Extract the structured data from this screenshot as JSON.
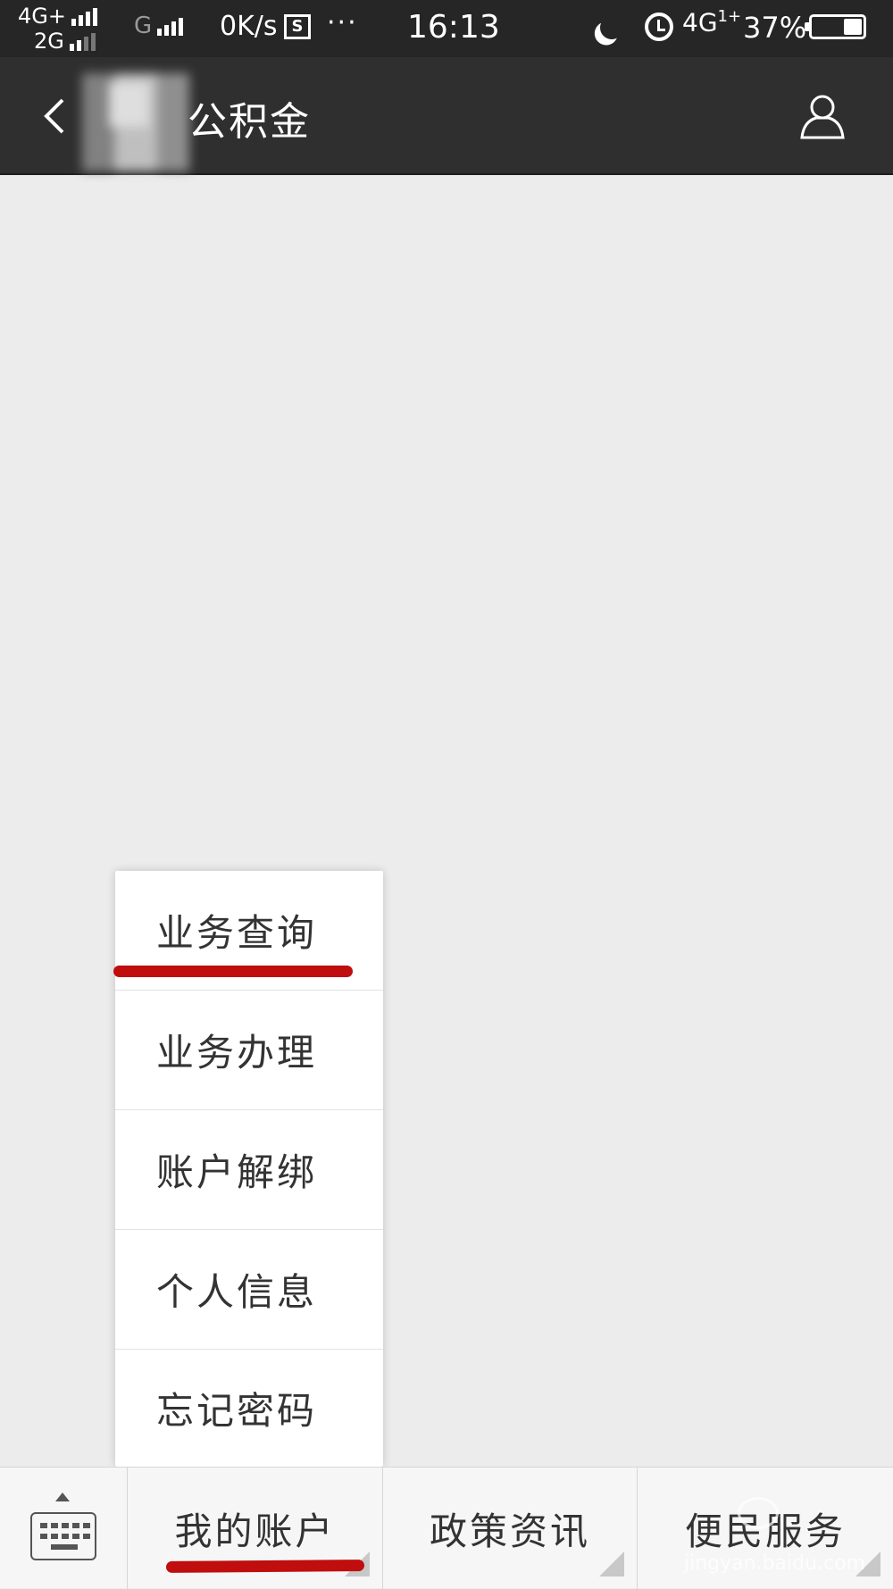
{
  "status_bar": {
    "network_1": "4G+",
    "network_2": "2G",
    "network_3": "G",
    "speed": "0K/s",
    "screenshot_icon": "S",
    "more": "···",
    "time": "16:13",
    "network_right": "4G",
    "network_right_sup": "1+",
    "battery": "37%"
  },
  "header": {
    "title": "公积金",
    "back_icon": "chevron-left-icon",
    "user_icon": "user-icon"
  },
  "popup_menu": {
    "items": [
      {
        "label": "业务查询"
      },
      {
        "label": "业务办理"
      },
      {
        "label": "账户解绑"
      },
      {
        "label": "个人信息"
      },
      {
        "label": "忘记密码"
      }
    ]
  },
  "bottom_menu": {
    "keyboard_icon": "keyboard-icon",
    "tabs": [
      {
        "label": "我的账户"
      },
      {
        "label": "政策资讯"
      },
      {
        "label": "便民服务"
      }
    ]
  },
  "watermark": {
    "text": "jingyan.baidu.com"
  },
  "colors": {
    "status_bar": "#262626",
    "title_bar": "#2f2f2f",
    "background": "#ececec",
    "annotation_red": "#c00d0d"
  }
}
